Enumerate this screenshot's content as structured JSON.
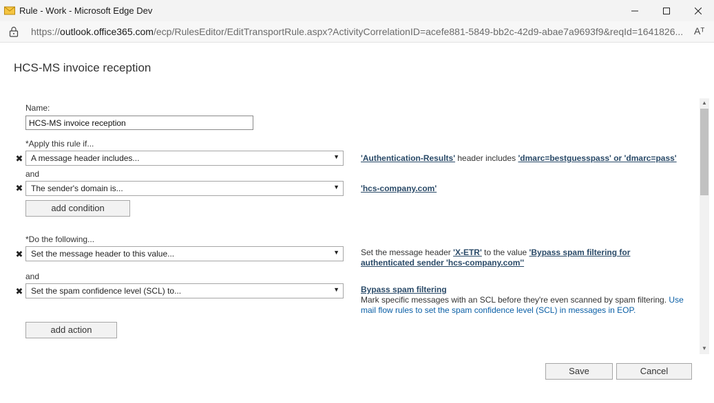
{
  "window": {
    "title": "Rule - Work - Microsoft Edge Dev",
    "minimize_icon": "minimize-icon",
    "maximize_icon": "maximize-icon",
    "close_icon": "close-icon"
  },
  "address": {
    "prefix": "https://",
    "host": "outlook.office365.com",
    "path": "/ecp/RulesEditor/EditTransportRule.aspx?ActivityCorrelationID=acefe881-5849-bb2c-42d9-abae7a9693f9&reqId=1641826...",
    "read_aloud": "Aᵀ"
  },
  "page": {
    "title": "HCS-MS invoice reception"
  },
  "form": {
    "name_label": "Name:",
    "name_value": "HCS-MS invoice reception",
    "apply_label": "*Apply this rule if...",
    "conditions": [
      {
        "select": "A message header includes..."
      },
      {
        "select": "The sender's domain is..."
      }
    ],
    "and_label": "and",
    "add_condition": "add condition",
    "do_label": "*Do the following...",
    "actions": [
      {
        "select": "Set the message header to this value..."
      },
      {
        "select": "Set the spam confidence level (SCL) to..."
      }
    ],
    "add_action": "add action"
  },
  "descriptions": {
    "cond1_link1": "'Authentication-Results'",
    "cond1_mid": " header includes ",
    "cond1_link2": "'dmarc=bestguesspass' or 'dmarc=pass'",
    "cond2_link": "'hcs-company.com'",
    "act1_pre": "Set the message header ",
    "act1_link1": "'X-ETR'",
    "act1_mid": " to the value ",
    "act1_link2": "'Bypass spam filtering for authenticated sender 'hcs-company.com''",
    "act2_link": "Bypass spam filtering",
    "act2_text": "Mark specific messages with an SCL before they're even scanned by spam filtering. ",
    "act2_help": "Use mail flow rules to set the spam confidence level (SCL) in messages in EOP."
  },
  "footer": {
    "save": "Save",
    "cancel": "Cancel"
  }
}
